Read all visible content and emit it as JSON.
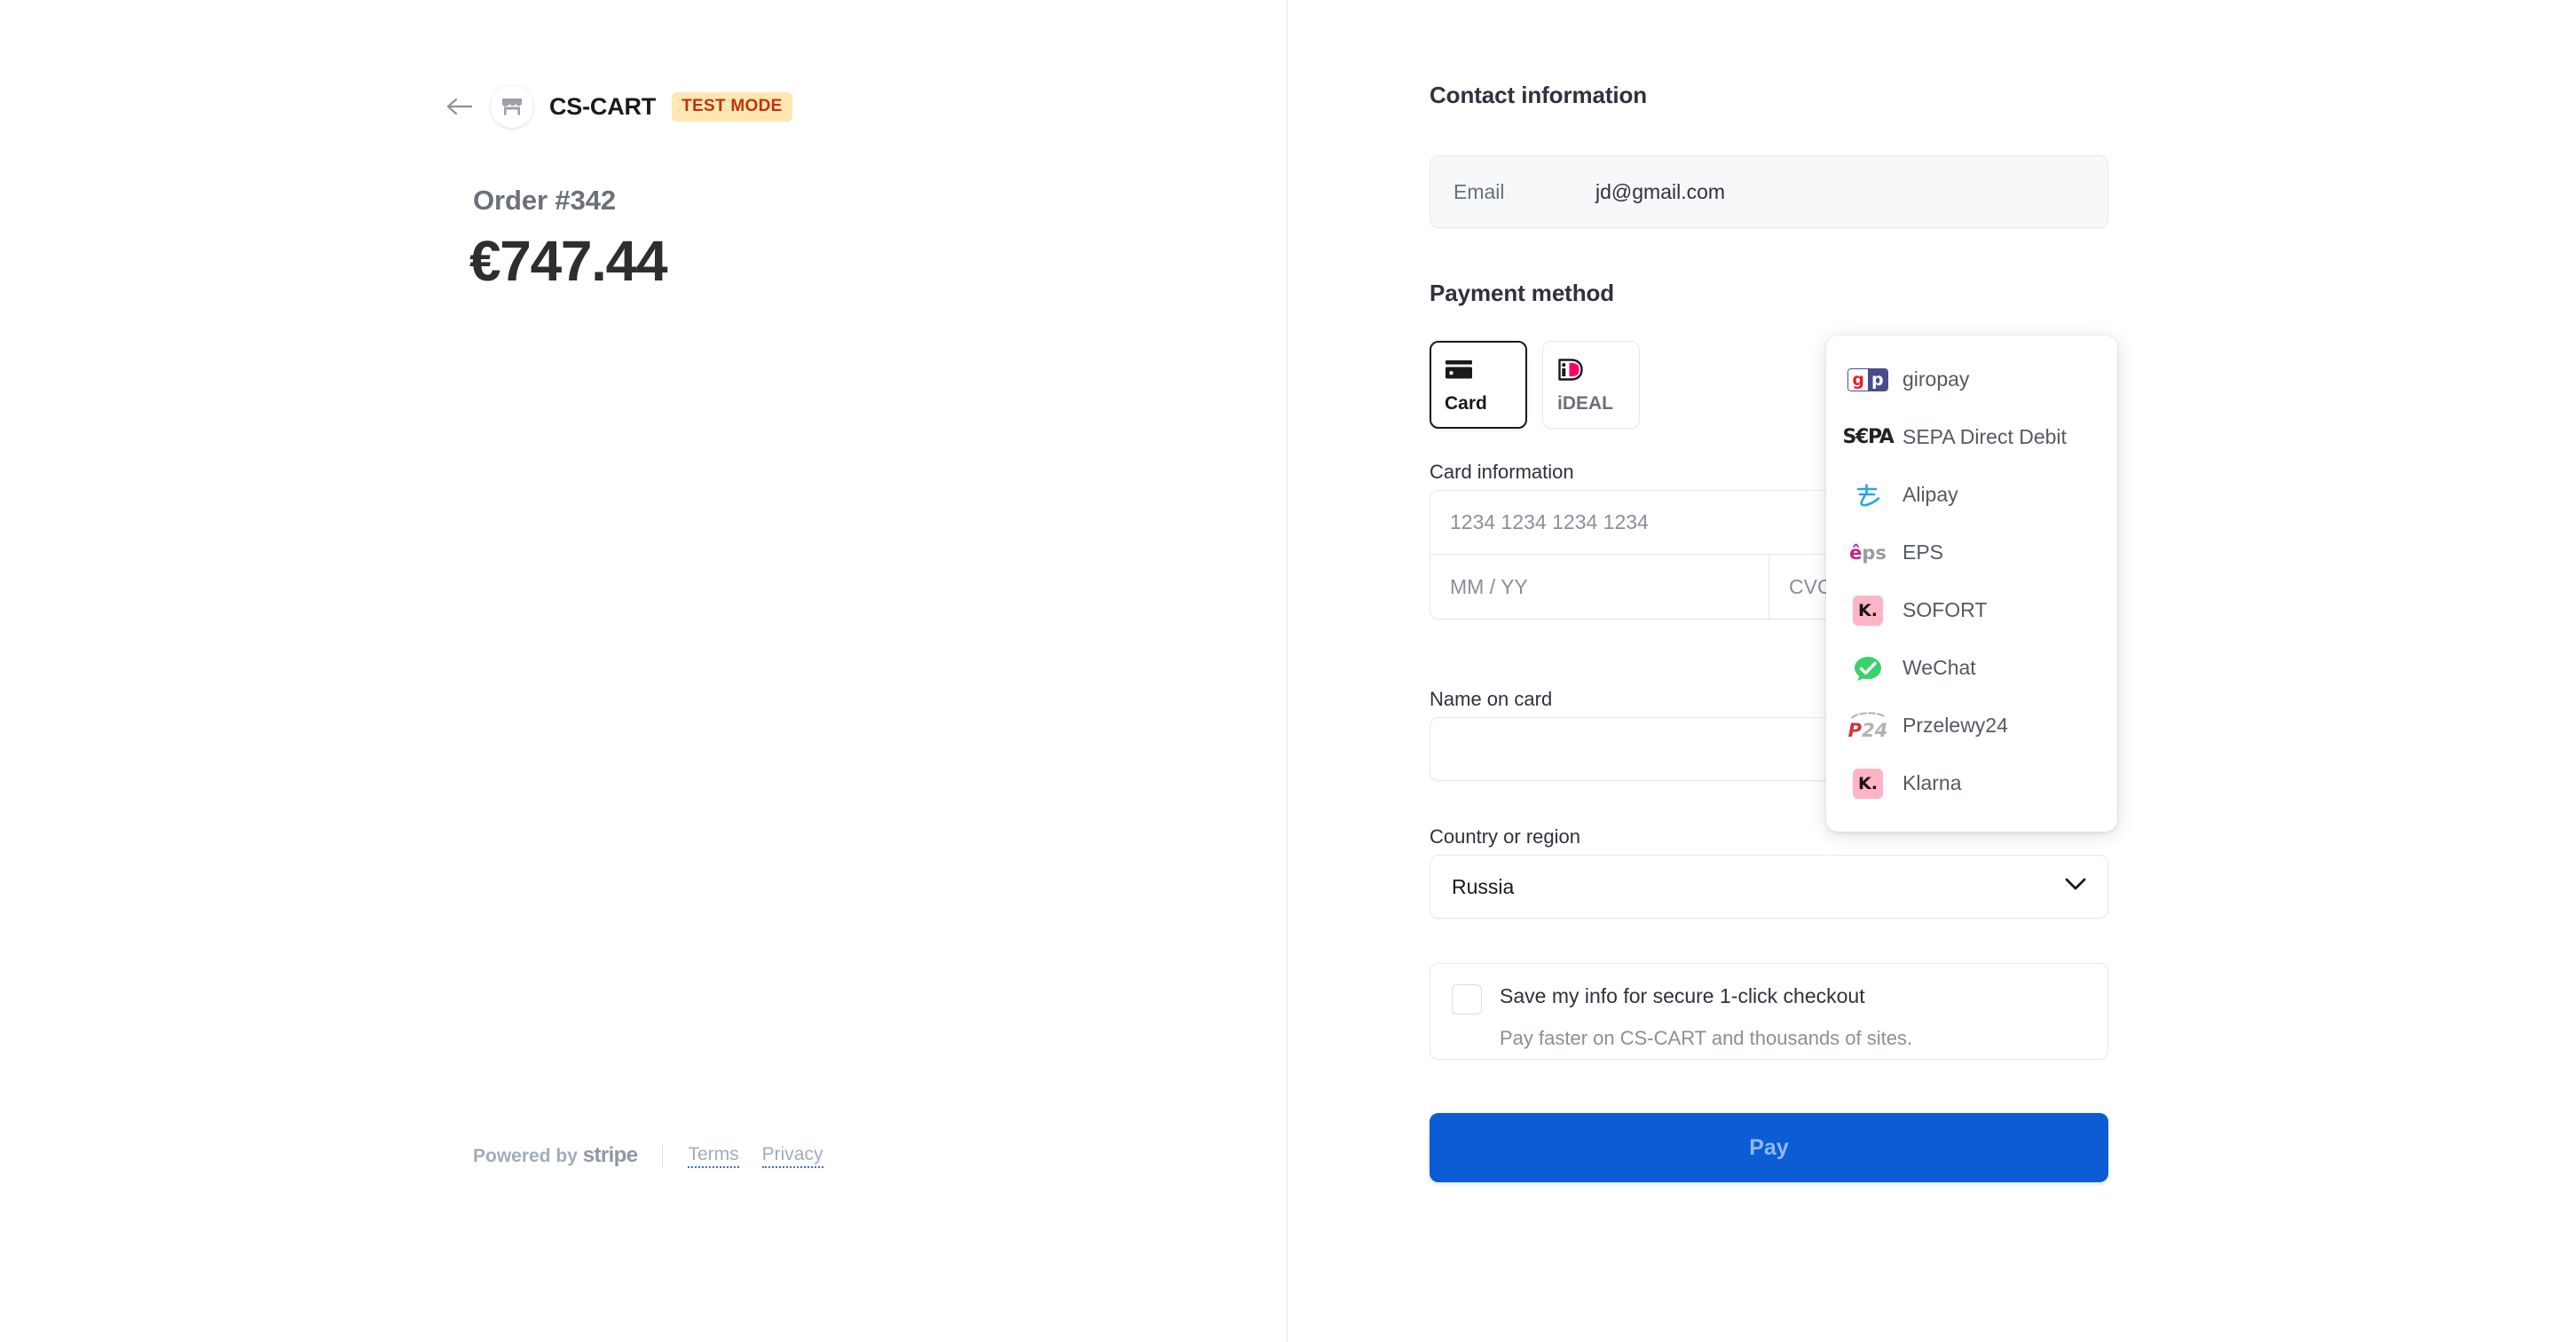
{
  "merchant": {
    "back_icon": "back-arrow-icon",
    "logo_icon": "storefront-icon",
    "name": "CS-CART",
    "test_badge": "TEST MODE"
  },
  "order": {
    "label": "Order #342",
    "amount": "€747.44"
  },
  "footer": {
    "powered_prefix": "Powered by ",
    "brand": "stripe",
    "terms": "Terms",
    "privacy": "Privacy"
  },
  "contact": {
    "title": "Contact information",
    "email_label": "Email",
    "email_value": "jd@gmail.com"
  },
  "payment_method": {
    "title": "Payment method",
    "tabs": [
      {
        "label": "Card",
        "icon": "credit-card-icon",
        "selected": true
      },
      {
        "label": "iDEAL",
        "icon": "ideal-icon",
        "selected": false
      }
    ],
    "dropdown_items": [
      {
        "label": "giropay",
        "icon": "giropay-icon"
      },
      {
        "label": "SEPA Direct Debit",
        "icon": "sepa-icon"
      },
      {
        "label": "Alipay",
        "icon": "alipay-icon"
      },
      {
        "label": "EPS",
        "icon": "eps-icon"
      },
      {
        "label": "SOFORT",
        "icon": "sofort-klarna-icon"
      },
      {
        "label": "WeChat",
        "icon": "wechat-icon"
      },
      {
        "label": "Przelewy24",
        "icon": "przelewy24-icon"
      },
      {
        "label": "Klarna",
        "icon": "klarna-icon"
      }
    ]
  },
  "card": {
    "title": "Card information",
    "number_placeholder": "1234 1234 1234 1234",
    "expiry_placeholder": "MM / YY",
    "cvc_placeholder": "CVC",
    "name_title": "Name on card",
    "name_value": ""
  },
  "country": {
    "title": "Country or region",
    "selected": "Russia",
    "chevron_icon": "chevron-down-icon"
  },
  "save_info": {
    "title": "Save my info for secure 1-click checkout",
    "subtitle": "Pay faster on CS-CART and thousands of sites.",
    "checked": false
  },
  "pay": {
    "label": "Pay"
  },
  "colors": {
    "accent": "#0b5cd5",
    "test_badge_bg": "#ffe7b3",
    "test_badge_text": "#c4320a",
    "klarna_pink": "#ffb3c7",
    "wechat_green": "#2dc100",
    "alipay_blue": "#27a6e5",
    "ideal_pink": "#ff0066",
    "giropay_purple": "#4b4b8f",
    "giropay_red": "#ed1c24",
    "eps_magenta": "#c2268f",
    "p24_red": "#d13239"
  }
}
